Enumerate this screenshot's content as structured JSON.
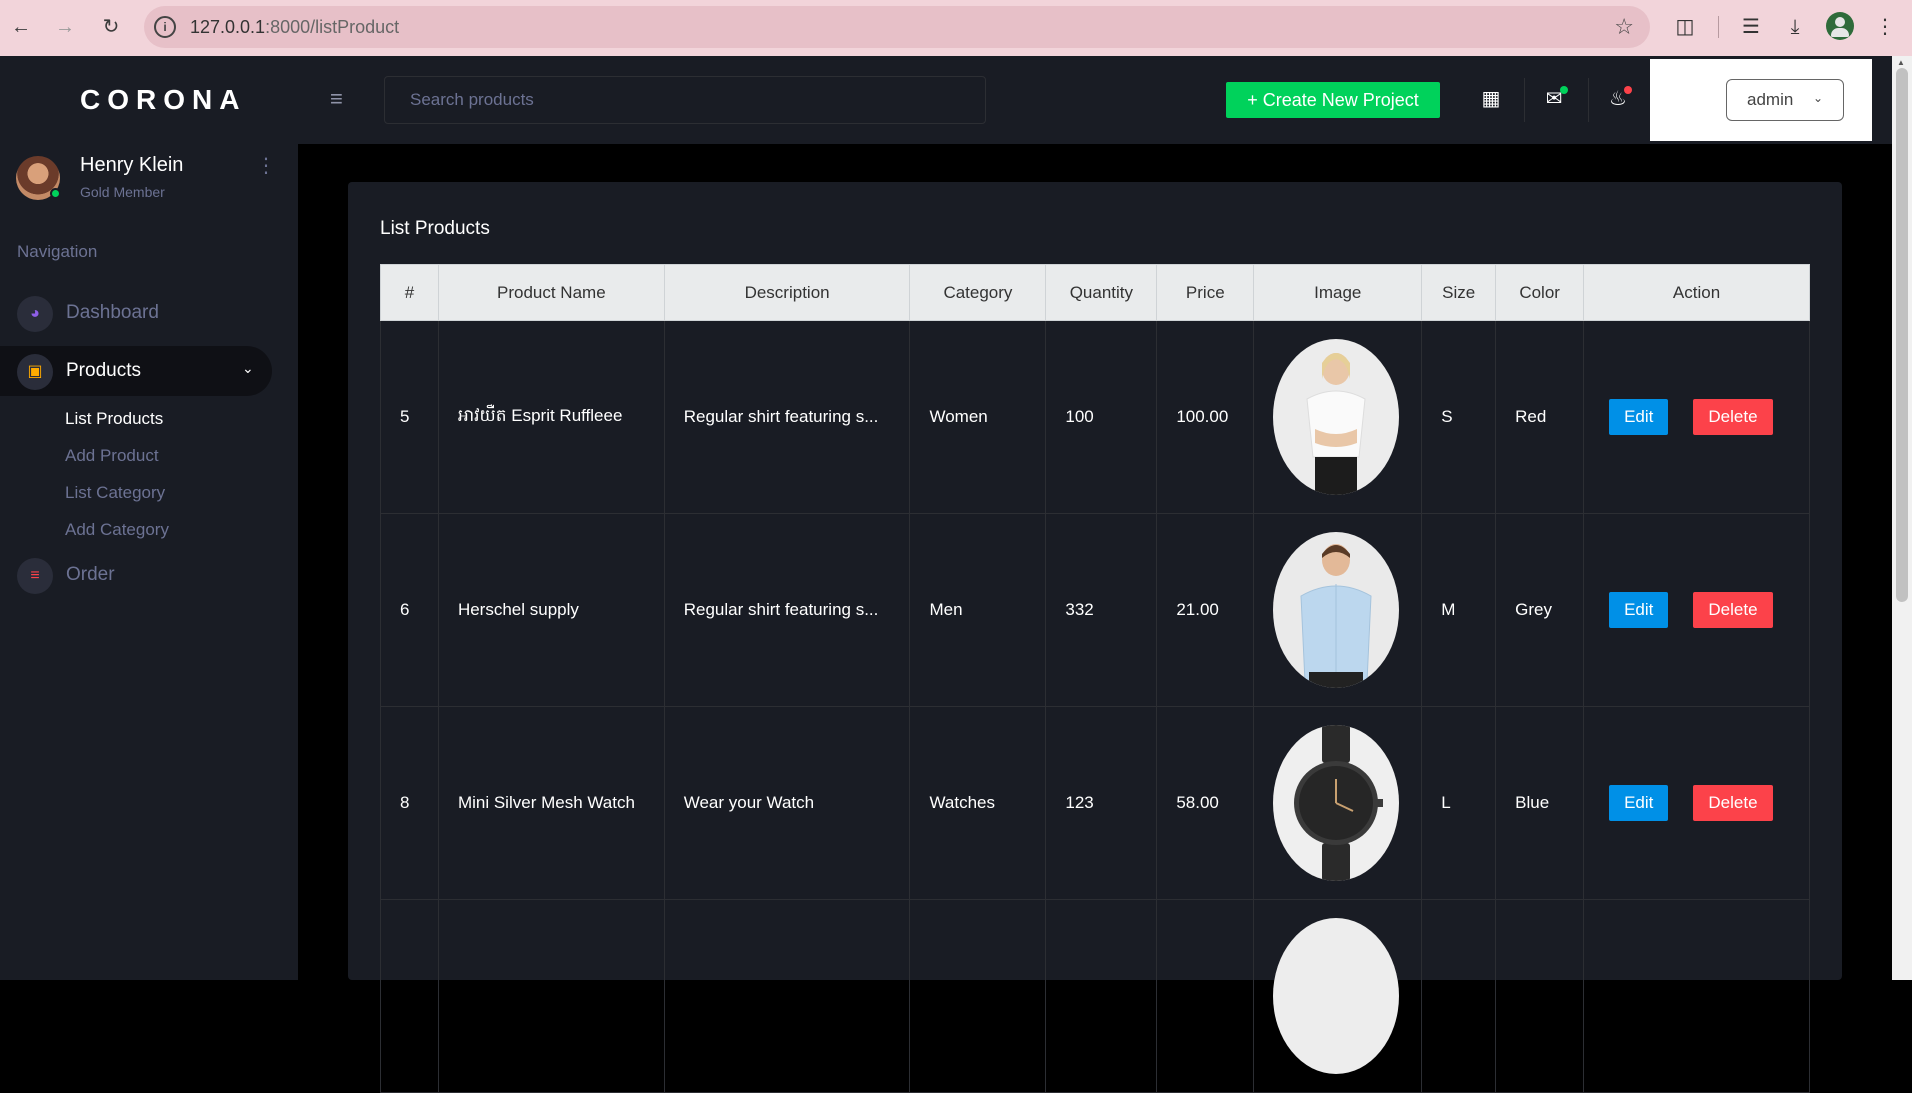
{
  "browser": {
    "url_host": "127.0.0.1",
    "url_path": ":8000/listProduct"
  },
  "sidebar": {
    "brand": "CORONA",
    "user": {
      "name": "Henry Klein",
      "role": "Gold Member"
    },
    "nav_caption": "Navigation",
    "items": [
      {
        "label": "Dashboard",
        "icon": "speedometer-icon"
      },
      {
        "label": "Products",
        "icon": "laptop-icon"
      },
      {
        "label": "Order",
        "icon": "playlist-icon"
      }
    ],
    "subitems": [
      "List Products",
      "Add Product",
      "List Category",
      "Add Category"
    ]
  },
  "navbar": {
    "search_placeholder": "Search products",
    "create_label": "+ Create New Project",
    "admin_label": "admin"
  },
  "main": {
    "title": "List Products",
    "columns": [
      "#",
      "Product Name",
      "Description",
      "Category",
      "Quantity",
      "Price",
      "Image",
      "Size",
      "Color",
      "Action"
    ],
    "rows": [
      {
        "id": "5",
        "name": "អាវយឺត Esprit Ruffleee",
        "description": "Regular shirt featuring s...",
        "category": "Women",
        "quantity": "100",
        "price": "100.00",
        "size": "S",
        "color": "Red",
        "image": "woman-white-tshirt"
      },
      {
        "id": "6",
        "name": "Herschel supply",
        "description": "Regular shirt featuring s...",
        "category": "Men",
        "quantity": "332",
        "price": "21.00",
        "size": "M",
        "color": "Grey",
        "image": "man-blue-shirt"
      },
      {
        "id": "8",
        "name": "Mini Silver Mesh Watch",
        "description": "Wear your Watch",
        "category": "Watches",
        "quantity": "123",
        "price": "58.00",
        "size": "L",
        "color": "Blue",
        "image": "black-watch"
      }
    ],
    "edit_label": "Edit",
    "delete_label": "Delete"
  },
  "colors": {
    "sidebar_bg": "#191c24",
    "create_btn": "#00d25b",
    "edit_btn": "#0090e7",
    "delete_btn": "#fc424a"
  }
}
